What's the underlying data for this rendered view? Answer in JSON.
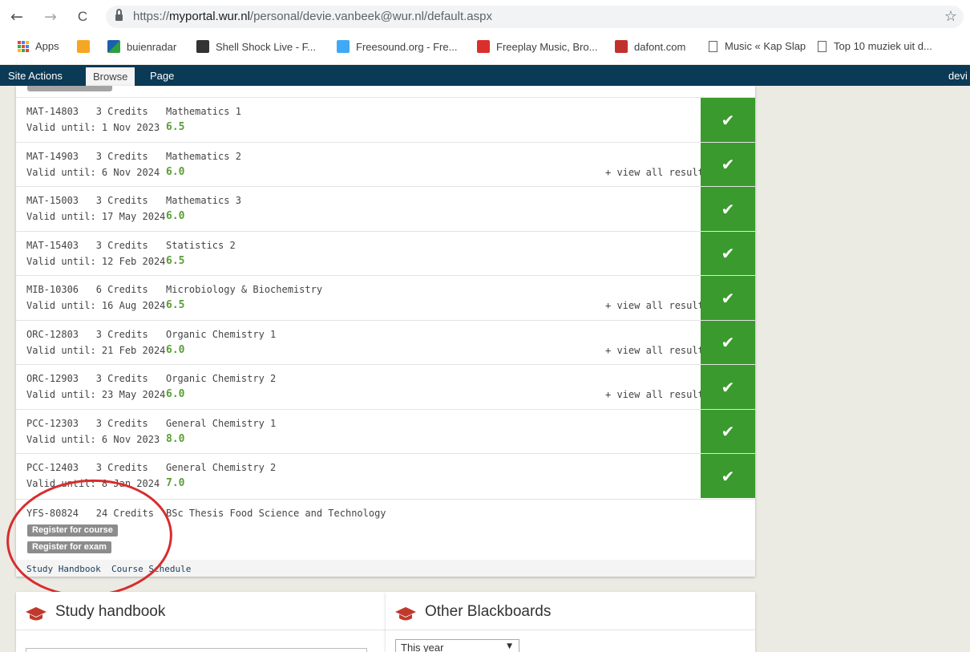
{
  "browser": {
    "back_glyph": "←",
    "forward_glyph": "→",
    "reload_glyph": "C",
    "url_prefix": "https://",
    "url_host": "myportal.wur.nl",
    "url_path": "/personal/devie.vanbeek@wur.nl/default.aspx",
    "star_glyph": "☆"
  },
  "bookmarks": [
    {
      "label": "Apps",
      "icon": "apps-grid-icon"
    },
    {
      "label": "",
      "icon": "orange-square-icon",
      "color": "#f5a623"
    },
    {
      "label": "buienradar",
      "icon": "buienradar-icon",
      "color": "#1b5fae"
    },
    {
      "label": "Shell Shock Live - F...",
      "icon": "shellshock-icon",
      "color": "#333333"
    },
    {
      "label": "Freesound.org - Fre...",
      "icon": "freesound-icon",
      "color": "#3fa9f5"
    },
    {
      "label": "Freeplay Music, Bro...",
      "icon": "freeplay-icon",
      "color": "#d9302c"
    },
    {
      "label": "dafont.com",
      "icon": "dafont-icon",
      "color": "#c0312d"
    },
    {
      "label": "Music « Kap Slap",
      "icon": "page-icon"
    },
    {
      "label": "Top 10 muziek uit d...",
      "icon": "page-icon"
    }
  ],
  "ribbon": {
    "site_actions": "Site Actions",
    "browse": "Browse",
    "page": "Page",
    "user": "devi"
  },
  "courses": [
    {
      "code": "MAT-14803",
      "credits": "3 Credits",
      "valid": "Valid until: 1 Nov 2023",
      "name": "Mathematics 1",
      "grade": "6.5",
      "view_all": ""
    },
    {
      "code": "MAT-14903",
      "credits": "3 Credits",
      "valid": "Valid until: 6 Nov 2024",
      "name": "Mathematics 2",
      "grade": "6.0",
      "view_all": "+ view all results"
    },
    {
      "code": "MAT-15003",
      "credits": "3 Credits",
      "valid": "Valid until: 17 May 2024",
      "name": "Mathematics 3",
      "grade": "6.0",
      "view_all": ""
    },
    {
      "code": "MAT-15403",
      "credits": "3 Credits",
      "valid": "Valid until: 12 Feb 2024",
      "name": "Statistics 2",
      "grade": "6.5",
      "view_all": ""
    },
    {
      "code": "MIB-10306",
      "credits": "6 Credits",
      "valid": "Valid until: 16 Aug 2024",
      "name": "Microbiology & Biochemistry",
      "grade": "6.5",
      "view_all": "+ view all results"
    },
    {
      "code": "ORC-12803",
      "credits": "3 Credits",
      "valid": "Valid until: 21 Feb 2024",
      "name": "Organic Chemistry 1",
      "grade": "6.0",
      "view_all": "+ view all results"
    },
    {
      "code": "ORC-12903",
      "credits": "3 Credits",
      "valid": "Valid until: 23 May 2024",
      "name": "Organic Chemistry 2",
      "grade": "6.0",
      "view_all": "+ view all results"
    },
    {
      "code": "PCC-12303",
      "credits": "3 Credits",
      "valid": "Valid until: 6 Nov 2023",
      "name": "General Chemistry 1",
      "grade": "8.0",
      "view_all": ""
    },
    {
      "code": "PCC-12403",
      "credits": "3 Credits",
      "valid": "Valid until: 8 Jan 2024",
      "name": "General Chemistry 2",
      "grade": "7.0",
      "view_all": ""
    }
  ],
  "check_glyph": "✔",
  "thesis": {
    "code": "YFS-80824",
    "credits": "24 Credits",
    "name": "BSc Thesis Food Science and Technology",
    "register_course": "Register for course",
    "register_exam": "Register for exam"
  },
  "footer_links": {
    "study_handbook": "Study Handbook",
    "course_schedule": "Course Schedule"
  },
  "cards": {
    "study_handbook_title": "Study handbook",
    "other_blackboards_title": "Other Blackboards",
    "year_select": "This year",
    "select_arrow": "▼"
  },
  "colors": {
    "ribbon": "#0a3a56",
    "check_bg": "#3a9a2d",
    "grade": "#5a9e35",
    "annotation": "#d82c2c",
    "cap_icon": "#c0392b"
  }
}
